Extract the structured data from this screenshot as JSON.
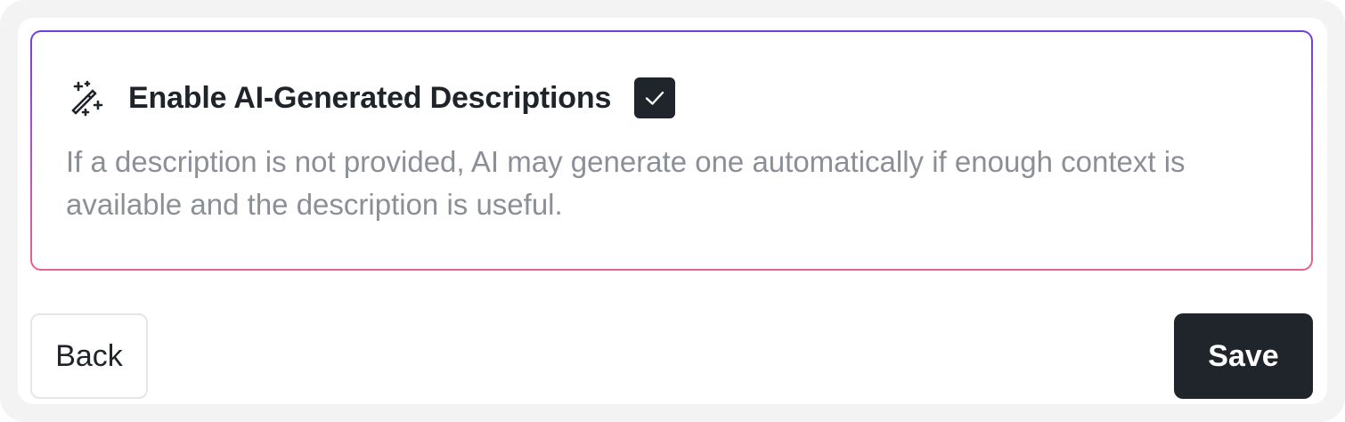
{
  "ai_setting": {
    "icon": "magic-wand-sparkles-icon",
    "title": "Enable AI-Generated Descriptions",
    "checked": true,
    "description": "If a description is not provided, AI may generate one automatically if enough context is available and the description is useful."
  },
  "actions": {
    "back_label": "Back",
    "save_label": "Save"
  },
  "colors": {
    "gradient_top": "#6d3fe0",
    "gradient_bottom": "#e4648e",
    "primary_dark": "#20242b",
    "muted_text": "#8b8f96"
  }
}
